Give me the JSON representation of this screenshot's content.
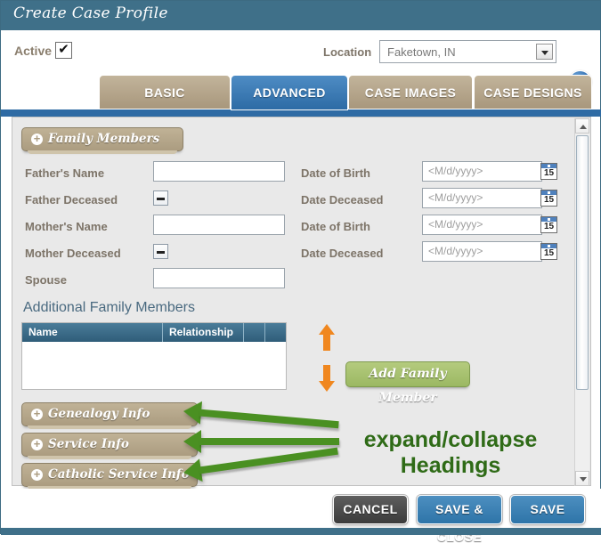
{
  "window": {
    "title": "Create Case Profile",
    "titlebar_color": "#3f7089"
  },
  "toolbar": {
    "active_label": "Active",
    "active_checked_glyph": "✔",
    "location_label": "Location",
    "location_value": "Faketown, IN",
    "location_options": [
      "Faketown, IN"
    ],
    "help_glyph": "?"
  },
  "tabs": [
    {
      "label": "BASIC",
      "active": false
    },
    {
      "label": "ADVANCED",
      "active": true
    },
    {
      "label": "CASE IMAGES",
      "active": false
    },
    {
      "label": "CASE DESIGNS",
      "active": false
    }
  ],
  "sections": {
    "family_members": {
      "label": "Family Members",
      "expand_glyph": "+"
    },
    "genealogy_info": {
      "label": "Genealogy Info",
      "expand_glyph": "+"
    },
    "service_info": {
      "label": "Service Info",
      "expand_glyph": "+"
    },
    "catholic_service_info": {
      "label": "Catholic Service Info",
      "expand_glyph": "+"
    }
  },
  "form": {
    "fathers_name_label": "Father's Name",
    "fathers_name_value": "",
    "father_dob_label": "Date of Birth",
    "father_dob_placeholder": "<M/d/yyyy>",
    "father_deceased_label": "Father Deceased",
    "father_date_deceased_label": "Date Deceased",
    "father_date_deceased_placeholder": "<M/d/yyyy>",
    "mothers_name_label": "Mother's Name",
    "mothers_name_value": "",
    "mother_dob_label": "Date of Birth",
    "mother_dob_placeholder": "<M/d/yyyy>",
    "mother_deceased_label": "Mother Deceased",
    "mother_date_deceased_label": "Date Deceased",
    "mother_date_deceased_placeholder": "<M/d/yyyy>",
    "spouse_label": "Spouse",
    "spouse_value": "",
    "calendar_day": "15"
  },
  "additional_family": {
    "heading": "Additional Family Members",
    "columns": [
      "Name",
      "Relationship",
      "",
      ""
    ],
    "rows": [],
    "add_button_label": "Add Family Member",
    "move_up_name": "arrow-up",
    "move_down_name": "arrow-down"
  },
  "annotation": {
    "line1": "expand/collapse",
    "line2": "Headings",
    "color": "#2f6b17",
    "arrow_count": 3
  },
  "footer": {
    "cancel_label": "CANCEL",
    "save_close_label": "SAVE & CLOSE",
    "save_label": "SAVE"
  }
}
